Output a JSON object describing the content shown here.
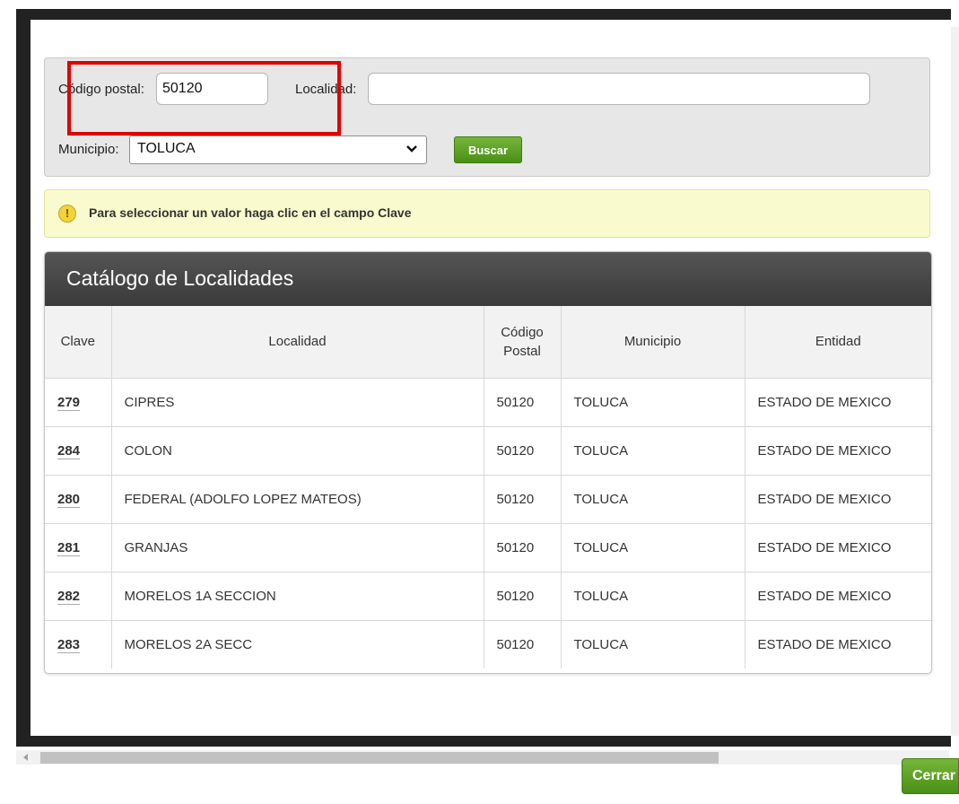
{
  "search": {
    "postal_label": "Código postal:",
    "postal_value": "50120",
    "localidad_label": "Localidad:",
    "localidad_value": "",
    "municipio_label": "Municipio:",
    "municipio_selected": "TOLUCA",
    "buscar_label": "Buscar"
  },
  "info": {
    "icon": "!",
    "message": "Para seleccionar un valor haga clic en el campo Clave"
  },
  "catalog": {
    "title": "Catálogo de Localidades",
    "columns": [
      "Clave",
      "Localidad",
      "Código Postal",
      "Municipio",
      "Entidad"
    ],
    "rows": [
      {
        "clave": "279",
        "localidad": "CIPRES",
        "cp": "50120",
        "municipio": "TOLUCA",
        "entidad": "ESTADO DE MEXICO"
      },
      {
        "clave": "284",
        "localidad": "COLON",
        "cp": "50120",
        "municipio": "TOLUCA",
        "entidad": "ESTADO DE MEXICO"
      },
      {
        "clave": "280",
        "localidad": "FEDERAL (ADOLFO LOPEZ MATEOS)",
        "cp": "50120",
        "municipio": "TOLUCA",
        "entidad": "ESTADO DE MEXICO"
      },
      {
        "clave": "281",
        "localidad": "GRANJAS",
        "cp": "50120",
        "municipio": "TOLUCA",
        "entidad": "ESTADO DE MEXICO"
      },
      {
        "clave": "282",
        "localidad": "MORELOS 1A SECCION",
        "cp": "50120",
        "municipio": "TOLUCA",
        "entidad": "ESTADO DE MEXICO"
      },
      {
        "clave": "283",
        "localidad": "MORELOS 2A SECC",
        "cp": "50120",
        "municipio": "TOLUCA",
        "entidad": "ESTADO DE MEXICO"
      }
    ]
  },
  "footer": {
    "cerrar_label": "Cerrar"
  },
  "colors": {
    "accent_green": "#4a8f16",
    "highlight_red": "#e00000",
    "info_bg": "#f9fbce",
    "header_dark": "#3a3a3a"
  }
}
